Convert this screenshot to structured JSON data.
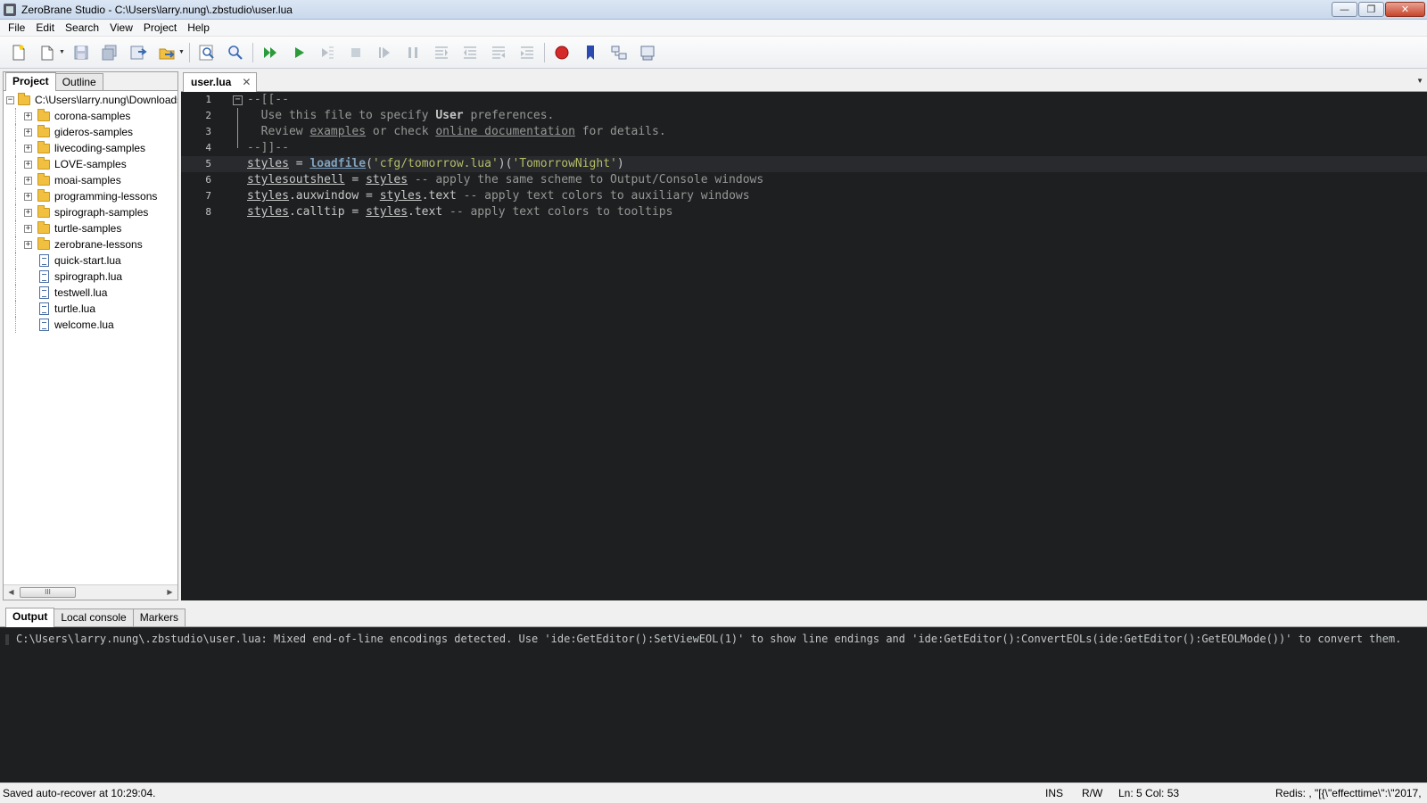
{
  "window": {
    "title": "ZeroBrane Studio - C:\\Users\\larry.nung\\.zbstudio\\user.lua",
    "minimize": "—",
    "maximize": "❐",
    "close": "✕"
  },
  "menu": [
    "File",
    "Edit",
    "Search",
    "View",
    "Project",
    "Help"
  ],
  "left_panel": {
    "tabs": [
      "Project",
      "Outline"
    ],
    "root": "C:\\Users\\larry.nung\\Downloads",
    "folders": [
      "corona-samples",
      "gideros-samples",
      "livecoding-samples",
      "LOVE-samples",
      "moai-samples",
      "programming-lessons",
      "spirograph-samples",
      "turtle-samples",
      "zerobrane-lessons"
    ],
    "files": [
      "quick-start.lua",
      "spirograph.lua",
      "testwell.lua",
      "turtle.lua",
      "welcome.lua"
    ]
  },
  "editor": {
    "tab": "user.lua",
    "lines": [
      {
        "n": "1",
        "parts": [
          {
            "c": "cm",
            "t": "--[[--"
          }
        ]
      },
      {
        "n": "2",
        "parts": [
          {
            "c": "cm",
            "t": "  Use this file to specify "
          },
          {
            "c": "kw",
            "t": "User"
          },
          {
            "c": "cm",
            "t": " preferences."
          }
        ]
      },
      {
        "n": "3",
        "parts": [
          {
            "c": "cm",
            "t": "  Review "
          },
          {
            "c": "cm ul",
            "t": "examples"
          },
          {
            "c": "cm",
            "t": " or check "
          },
          {
            "c": "cm ul",
            "t": "online documentation"
          },
          {
            "c": "cm",
            "t": " for details."
          }
        ]
      },
      {
        "n": "4",
        "parts": [
          {
            "c": "cm",
            "t": "--]]--"
          }
        ]
      },
      {
        "n": "5",
        "parts": [
          {
            "c": "id",
            "t": "styles"
          },
          {
            "c": "",
            "t": " = "
          },
          {
            "c": "fn",
            "t": "loadfile"
          },
          {
            "c": "",
            "t": "("
          },
          {
            "c": "str",
            "t": "'cfg/tomorrow.lua'"
          },
          {
            "c": "",
            "t": ")("
          },
          {
            "c": "str",
            "t": "'TomorrowNight'"
          },
          {
            "c": "",
            "t": ")"
          }
        ]
      },
      {
        "n": "6",
        "parts": [
          {
            "c": "id",
            "t": "stylesoutshell"
          },
          {
            "c": "",
            "t": " = "
          },
          {
            "c": "id",
            "t": "styles"
          },
          {
            "c": "cm",
            "t": " -- apply the same scheme to Output/Console windows"
          }
        ]
      },
      {
        "n": "7",
        "parts": [
          {
            "c": "id",
            "t": "styles"
          },
          {
            "c": "",
            "t": ".auxwindow = "
          },
          {
            "c": "id",
            "t": "styles"
          },
          {
            "c": "",
            "t": ".text"
          },
          {
            "c": "cm",
            "t": " -- apply text colors to auxiliary windows"
          }
        ]
      },
      {
        "n": "8",
        "parts": [
          {
            "c": "id",
            "t": "styles"
          },
          {
            "c": "",
            "t": ".calltip = "
          },
          {
            "c": "id",
            "t": "styles"
          },
          {
            "c": "",
            "t": ".text"
          },
          {
            "c": "cm",
            "t": " -- apply text colors to tooltips"
          }
        ]
      }
    ]
  },
  "output_panel": {
    "tabs": [
      "Output",
      "Local console",
      "Markers"
    ],
    "text": "C:\\Users\\larry.nung\\.zbstudio\\user.lua: Mixed end-of-line encodings detected. Use 'ide:GetEditor():SetViewEOL(1)' to show line endings and 'ide:GetEditor():ConvertEOLs(ide:GetEditor():GetEOLMode())' to convert them."
  },
  "status": {
    "message": "Saved auto-recover at 10:29:04.",
    "mode": "INS",
    "access": "R/W",
    "position": "Ln: 5 Col: 53",
    "redis": "Redis: , \"[{\\\"effecttime\\\":\\\"2017,"
  },
  "toolbar": [
    "new-file-icon",
    "open-file-icon",
    "save-icon",
    "save-all-icon",
    "project-directory-icon",
    "choose-project-icon",
    "find-icon",
    "find-in-files-icon",
    "start-debug-icon",
    "run-icon",
    "run-to-cursor-icon",
    "stop-icon",
    "step-into-icon",
    "break-icon",
    "step-over-icon",
    "step-out-icon",
    "step-back-icon",
    "step-forward-icon",
    "toggle-breakpoint-icon",
    "toggle-bookmark-icon",
    "stack-window-icon",
    "watch-window-icon"
  ],
  "colors": {
    "editor_bg": "#1d1f21",
    "comment": "#969896",
    "string": "#b5bd68",
    "function": "#81a2be",
    "text": "#c5c8c6"
  }
}
